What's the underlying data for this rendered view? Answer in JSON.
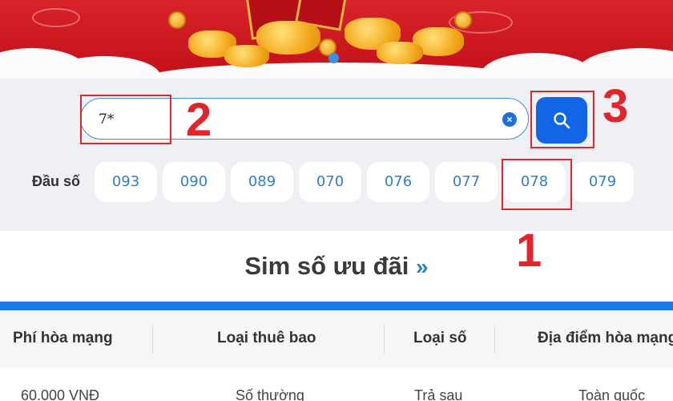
{
  "search": {
    "value": "7*"
  },
  "prefixes": {
    "label": "Đầu số",
    "items": [
      "093",
      "090",
      "089",
      "070",
      "076",
      "077",
      "078",
      "079"
    ]
  },
  "section": {
    "title": "Sim số ưu đãi",
    "chevron": "»"
  },
  "table": {
    "headers": [
      "Phí hòa mạng",
      "Loại thuê bao",
      "Loại số",
      "Địa điểm hòa mạng"
    ],
    "row": [
      "60.000 VNĐ",
      "Số thường",
      "Trả sau",
      "Toàn quốc"
    ]
  },
  "annotations": [
    "1",
    "2",
    "3"
  ],
  "colors": {
    "accent": "#1265e6",
    "banner": "#d8232a",
    "annotation": "#e0262c",
    "chip_text": "#2f7fcf"
  },
  "icons": {
    "search": "search-icon",
    "clear": "clear-icon"
  }
}
